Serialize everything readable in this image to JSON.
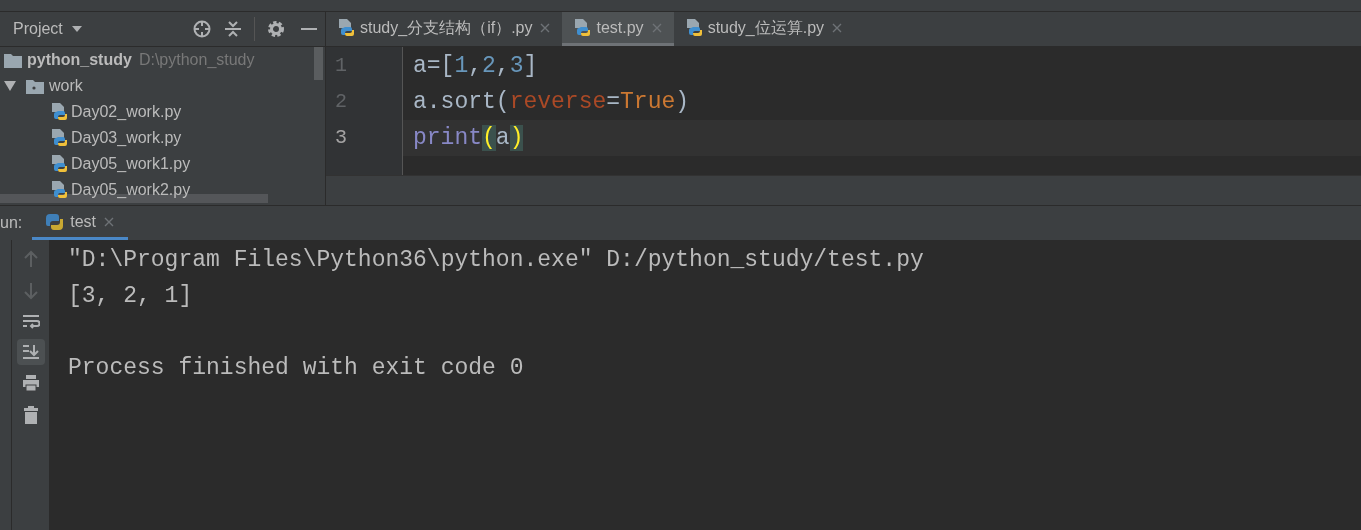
{
  "project_panel": {
    "title": "Project",
    "tree": [
      {
        "kind": "root",
        "name": "python_study",
        "path": "D:\\python_study",
        "children": [
          {
            "kind": "folder",
            "name": "work",
            "expanded": true,
            "children": [
              {
                "kind": "file",
                "name": "Day02_work.py"
              },
              {
                "kind": "file",
                "name": "Day03_work.py"
              },
              {
                "kind": "file",
                "name": "Day05_work1.py"
              },
              {
                "kind": "file",
                "name": "Day05_work2.py"
              }
            ]
          }
        ]
      }
    ]
  },
  "editor_tabs": [
    {
      "label": "study_分支结构（if）.py",
      "selected": false
    },
    {
      "label": "test.py",
      "selected": true
    },
    {
      "label": "study_位运算.py",
      "selected": false
    }
  ],
  "code_lines": [
    {
      "number": "1",
      "current": false,
      "tokens": [
        {
          "kind": "plain",
          "text": "a=["
        },
        {
          "kind": "number",
          "text": "1"
        },
        {
          "kind": "plain",
          "text": ","
        },
        {
          "kind": "number",
          "text": "2"
        },
        {
          "kind": "plain",
          "text": ","
        },
        {
          "kind": "number",
          "text": "3"
        },
        {
          "kind": "plain",
          "text": "]"
        }
      ]
    },
    {
      "number": "2",
      "current": false,
      "tokens": [
        {
          "kind": "plain",
          "text": "a.sort("
        },
        {
          "kind": "param",
          "text": "reverse"
        },
        {
          "kind": "plain",
          "text": "="
        },
        {
          "kind": "keyword",
          "text": "True"
        },
        {
          "kind": "plain",
          "text": ")"
        }
      ]
    },
    {
      "number": "3",
      "current": true,
      "tokens": [
        {
          "kind": "builtin",
          "text": "print"
        },
        {
          "kind": "brace",
          "text": "("
        },
        {
          "kind": "plain",
          "text": "a"
        },
        {
          "kind": "brace",
          "text": ")"
        }
      ]
    }
  ],
  "run_panel": {
    "label": "un:",
    "tabs": [
      {
        "label": "test",
        "selected": true
      }
    ],
    "output": [
      "\"D:\\Program Files\\Python36\\python.exe\" D:/python_study/test.py",
      "[3, 2, 1]"
    ],
    "exit_message": "Process finished with exit code 0"
  }
}
